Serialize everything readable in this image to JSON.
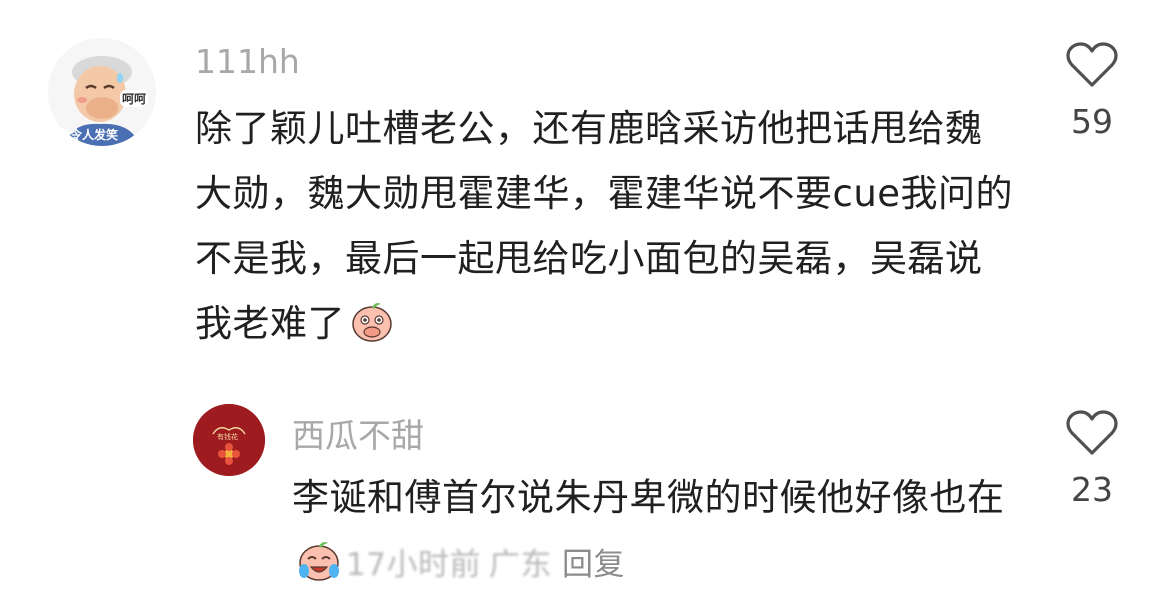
{
  "comments": [
    {
      "username": "111hh",
      "avatar": {
        "icon": "old-man-laughing-avatar-icon",
        "badge_text": "呵呵",
        "caption_text": "是令人发笑"
      },
      "text": "除了颖儿吐槽老公，还有鹿晗采访他把话甩给魏大勋，魏大勋甩霍建华，霍建华说不要cue我问的不是我，最后一起甩给吃小面包的吴磊，吴磊说我老难了",
      "emoji": "covering-mouth-laugh-emoji",
      "likes": "59"
    },
    {
      "username": "西瓜不甜",
      "avatar": {
        "icon": "red-flower-avatar-icon",
        "caption_text": "有钱花"
      },
      "text": "李诞和傅首尔说朱丹卑微的时候他好像也在",
      "emoji": "crying-laughing-emoji",
      "time": "17小时前",
      "location": "广东",
      "reply_label": "回复",
      "likes": "23"
    }
  ],
  "colors": {
    "username": "#a8a8a8",
    "body_text": "#202020",
    "like_outline": "#505050",
    "avatar2_bg": "#9e1b1f"
  }
}
